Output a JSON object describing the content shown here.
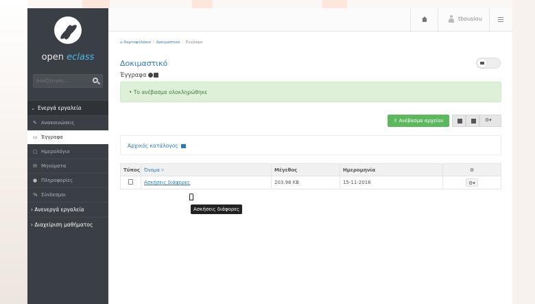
{
  "sidebar": {
    "logo_text_plain": "open ",
    "logo_text_accent": "eclass",
    "search": {
      "placeholder": "Αναζήτηση..."
    },
    "active_section": "Ενεργά εργαλεία",
    "items": [
      {
        "label": "Ανακοινώσεις",
        "icon": "bullhorn-icon"
      },
      {
        "label": "Έγγραφα",
        "icon": "folder-icon",
        "active": true
      },
      {
        "label": "Ημερολόγιο",
        "icon": "calendar-icon"
      },
      {
        "label": "Μηνύματα",
        "icon": "envelope-icon"
      },
      {
        "label": "Πληροφορίες",
        "icon": "info-icon"
      },
      {
        "label": "Σύνδεσμοι",
        "icon": "link-icon"
      }
    ],
    "collapsed_sections": [
      "Ανενεργά εργαλεία",
      "Διαχείριση μαθήματος"
    ]
  },
  "topbar": {
    "username": "tbousiou"
  },
  "breadcrumb": [
    "Χαρτοφυλάκιο",
    "Δοκιμαστικό",
    "Έγγραφα"
  ],
  "page": {
    "title": "Δοκιμαστικό",
    "subtitle": "Έγγραφα",
    "alert": "Το ανέβασμα ολοκληρώθηκε",
    "upload_label": "Ανέβασμα αρχείου",
    "root_dir": "Αρχικός κατάλογος"
  },
  "table": {
    "headers": {
      "type": "Τύπος",
      "name": "Όνομα",
      "size": "Μέγεθος",
      "date": "Ημερομηνία"
    },
    "rows": [
      {
        "name": "Ασκήσεις διάφορες",
        "size": "203.98 KB",
        "date": "15-11-2016"
      }
    ]
  },
  "tooltip": "Ασκήσεις διάφορες",
  "colors": {
    "sidebar": "#3a3e45",
    "accent": "#2a7ab8",
    "success": "#5cb85c",
    "alert_bg": "#dff0d8"
  }
}
